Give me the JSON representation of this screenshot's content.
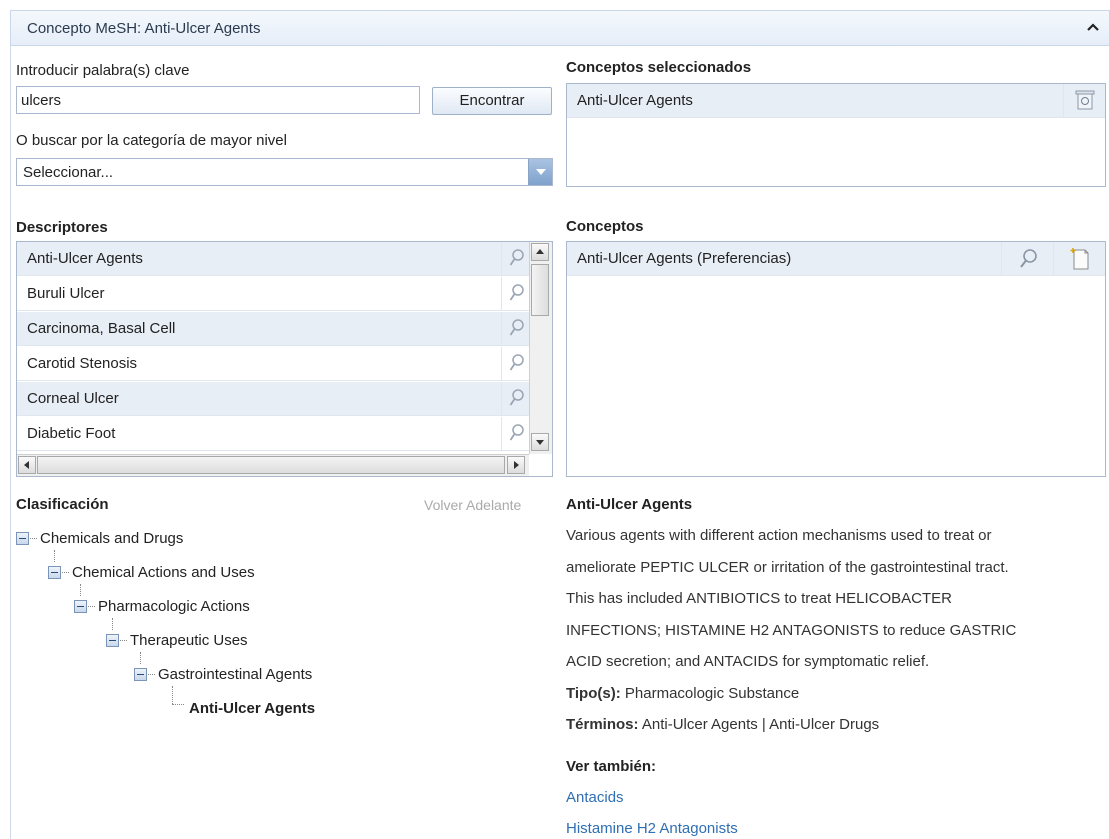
{
  "header": {
    "title": "Concepto MeSH: Anti-Ulcer Agents",
    "collapse_icon": "chevron-up-icon"
  },
  "search": {
    "keyword_label": "Introducir palabra(s) clave",
    "keyword_value": "ulcers",
    "find_button": "Encontrar",
    "category_label": "O buscar por la categoría de mayor nivel",
    "category_value": "Seleccionar..."
  },
  "selected_concepts": {
    "title": "Conceptos seleccionados",
    "items": [
      {
        "label": "Anti-Ulcer Agents",
        "icon": "remove-icon"
      }
    ]
  },
  "descriptors": {
    "title": "Descriptores",
    "items": [
      {
        "label": "Anti-Ulcer Agents"
      },
      {
        "label": "Buruli Ulcer"
      },
      {
        "label": "Carcinoma, Basal Cell"
      },
      {
        "label": "Carotid Stenosis"
      },
      {
        "label": "Corneal Ulcer"
      },
      {
        "label": "Diabetic Foot"
      }
    ]
  },
  "concepts": {
    "title": "Conceptos",
    "items": [
      {
        "label": "Anti-Ulcer Agents (Preferencias)"
      }
    ]
  },
  "classification": {
    "title": "Clasificación",
    "nav": "Volver Adelante",
    "tree": [
      "Chemicals and Drugs",
      "Chemical Actions and Uses",
      "Pharmacologic Actions",
      "Therapeutic Uses",
      "Gastrointestinal Agents",
      "Anti-Ulcer Agents"
    ]
  },
  "details": {
    "title": "Anti-Ulcer Agents",
    "description": [
      "Various agents with different action mechanisms used to treat or",
      "ameliorate PEPTIC ULCER or irritation of the gastrointestinal tract.",
      "This has included ANTIBIOTICS to treat HELICOBACTER",
      "INFECTIONS; HISTAMINE H2 ANTAGONISTS to reduce GASTRIC",
      "ACID secretion; and ANTACIDS for symptomatic relief."
    ],
    "types_label": "Tipo(s):",
    "types_value": "Pharmacologic Substance",
    "terms_label": "Términos:",
    "terms_value": "Anti-Ulcer Agents | Anti-Ulcer Drugs",
    "see_also_label": "Ver también:",
    "see_also": [
      "Antacids",
      "Histamine H2 Antagonists"
    ]
  },
  "colors": {
    "link": "#2f6fb3",
    "row_alt": "#e8eef6",
    "header_bg": "#e6eef8"
  }
}
